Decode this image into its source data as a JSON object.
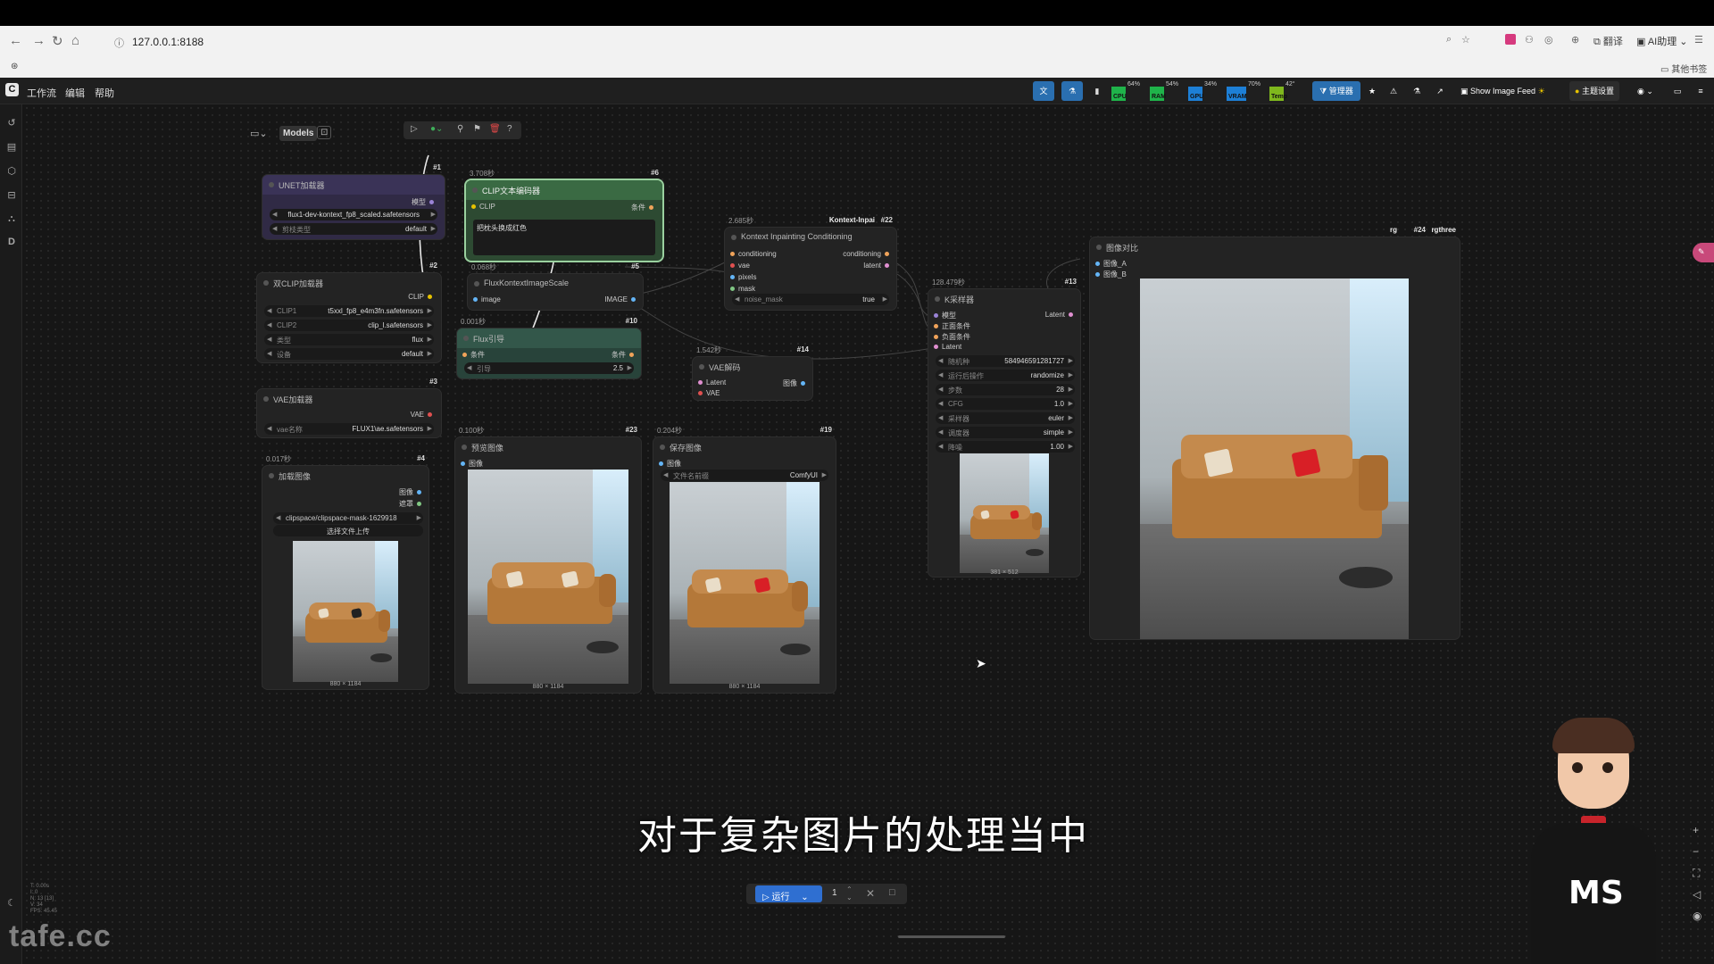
{
  "browser": {
    "url": "127.0.0.1:8188",
    "bookmarks_other": "其他书签",
    "ext_ai": "AI助理"
  },
  "app": {
    "menu": [
      "工作流",
      "编辑",
      "帮助"
    ],
    "toolbar": {
      "show_image_feed": "Show Image Feed",
      "manager": "管理器",
      "theme": "主题设置"
    },
    "stats": [
      {
        "label": "CPU",
        "pct": "64%",
        "color": "#1fb34a"
      },
      {
        "label": "RAM",
        "pct": "54%",
        "color": "#1fb34a"
      },
      {
        "label": "GPU",
        "pct": "34%",
        "color": "#1d7fd6"
      },
      {
        "label": "VRAM",
        "pct": "70%",
        "color": "#1d7fd6"
      },
      {
        "label": "Temp",
        "pct": "42°",
        "color": "#7fb81d"
      }
    ],
    "models_label": "Models"
  },
  "nodes": {
    "unet": {
      "id": "#1",
      "title": "UNET加载器",
      "out": "模型",
      "w1": {
        "n": "",
        "v": "flux1-dev-kontext_fp8_scaled.safetensors"
      },
      "w2": {
        "n": "剪枝类型",
        "v": "default"
      }
    },
    "clip_text": {
      "id": "#6",
      "time": "3.708秒",
      "title": "CLIP文本编码器",
      "in": "CLIP",
      "out": "条件",
      "text": "把枕头换成红色"
    },
    "dual_clip": {
      "id": "#2",
      "title": "双CLIP加载器",
      "out": "CLIP",
      "w": [
        {
          "n": "CLIP1",
          "v": "t5xxl_fp8_e4m3fn.safetensors"
        },
        {
          "n": "CLIP2",
          "v": "clip_l.safetensors"
        },
        {
          "n": "类型",
          "v": "flux"
        },
        {
          "n": "设备",
          "v": "default"
        }
      ]
    },
    "scale": {
      "id": "#5",
      "time": "0.068秒",
      "title": "FluxKontextImageScale",
      "in": "image",
      "out": "IMAGE"
    },
    "flux_guide": {
      "id": "#10",
      "time": "0.001秒",
      "title": "Flux引导",
      "in": "条件",
      "out": "条件",
      "w": {
        "n": "引导",
        "v": "2.5"
      }
    },
    "kontext": {
      "id": "#22",
      "time": "2.685秒",
      "badge": "Kontext-Inpai",
      "title": "Kontext Inpainting Conditioning",
      "ins": [
        "conditioning",
        "vae",
        "pixels",
        "mask"
      ],
      "outs": [
        "conditioning",
        "latent"
      ],
      "w": {
        "n": "noise_mask",
        "v": "true"
      }
    },
    "vae_loader": {
      "id": "#3",
      "title": "VAE加载器",
      "out": "VAE",
      "w": {
        "n": "vae名称",
        "v": "FLUX1\\ae.safetensors"
      }
    },
    "vae_decode": {
      "id": "#14",
      "time": "1.542秒",
      "title": "VAE解码",
      "ins": [
        "Latent",
        "VAE"
      ],
      "out": "图像"
    },
    "load_image": {
      "id": "#4",
      "time": "0.017秒",
      "title": "加载图像",
      "outs": [
        "图像",
        "遮罩"
      ],
      "file": "clipspace/clipspace-mask-1629918",
      "upload": "选择文件上传",
      "size": "880 × 1184"
    },
    "preview": {
      "id": "#23",
      "time": "0.100秒",
      "title": "预览图像",
      "in": "图像",
      "size": "880 × 1184"
    },
    "save": {
      "id": "#19",
      "time": "0.204秒",
      "title": "保存图像",
      "in": "图像",
      "w": {
        "n": "文件名前缀",
        "v": "ComfyUI"
      },
      "size": "880 × 1184"
    },
    "ksampler": {
      "id": "#13",
      "time": "128.479秒",
      "title": "K采样器",
      "ins": [
        "模型",
        "正面条件",
        "负面条件",
        "Latent"
      ],
      "out": "Latent",
      "w": [
        {
          "n": "随机种",
          "v": "584946591281727"
        },
        {
          "n": "运行后操作",
          "v": "randomize"
        },
        {
          "n": "步数",
          "v": "28"
        },
        {
          "n": "CFG",
          "v": "1.0"
        },
        {
          "n": "采样器",
          "v": "euler"
        },
        {
          "n": "调度器",
          "v": "simple"
        },
        {
          "n": "降噪",
          "v": "1.00"
        }
      ],
      "size": "381 × 512"
    },
    "compare": {
      "id": "#24",
      "badge": "rg",
      "badge2": "rgthree",
      "title": "图像对比",
      "ins": [
        "图像_A",
        "图像_B"
      ]
    }
  },
  "run": {
    "label": "运行",
    "count": "1"
  },
  "subtitle": "对于复杂图片的处理当中",
  "avatar_text": "MS",
  "watermark": "tafe.cc",
  "minimap": [
    "T: 0.00s",
    "I: 0",
    "N: 13 [13]",
    "V: 34",
    "FPS: 45.45"
  ]
}
